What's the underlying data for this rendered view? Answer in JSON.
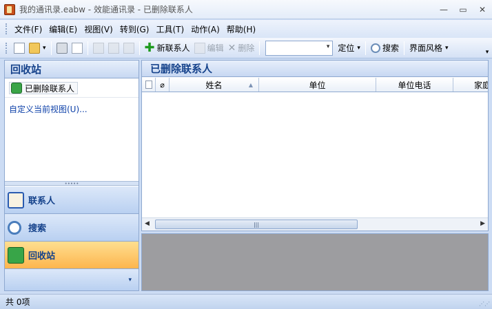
{
  "window": {
    "title": "我的通讯录.eabw - 效能通讯录 - 已删除联系人",
    "minimize_glyph": "—",
    "maximize_glyph": "▭",
    "close_glyph": "✕"
  },
  "menu": [
    {
      "label": "文件(F)"
    },
    {
      "label": "编辑(E)"
    },
    {
      "label": "视图(V)"
    },
    {
      "label": "转到(G)"
    },
    {
      "label": "工具(T)"
    },
    {
      "label": "动作(A)"
    },
    {
      "label": "帮助(H)"
    }
  ],
  "toolbar": {
    "new_contact": "新联系人",
    "edit": "编辑",
    "delete": "删除",
    "combo_value": "",
    "locate": "定位",
    "search": "搜索",
    "theme": "界面风格",
    "icons": {
      "new_doc": "new-document-icon",
      "open": "open-folder-icon",
      "print": "print-icon",
      "preview": "print-preview-icon",
      "cut": "cut-icon",
      "copy": "copy-icon",
      "paste": "paste-icon",
      "plus": "add-icon",
      "edit": "edit-icon",
      "delete": "delete-icon",
      "search": "search-icon"
    }
  },
  "left_pane": {
    "header": "回收站",
    "folder_item": "已删除联系人",
    "customize_link": "自定义当前视图(U)...",
    "nav_buttons": [
      {
        "label": "联系人",
        "icon": "contacts-icon"
      },
      {
        "label": "搜索",
        "icon": "search-icon"
      },
      {
        "label": "回收站",
        "icon": "recycle-bin-icon",
        "active": true
      }
    ]
  },
  "right_pane": {
    "header": "已删除联系人",
    "columns": [
      "",
      "",
      "姓名",
      "单位",
      "单位电话",
      "家庭"
    ],
    "rows": []
  },
  "status": {
    "text": "共 0项"
  },
  "colors": {
    "accent_header_text": "#15428b",
    "active_nav": "#fdb54e",
    "frame_blue": "#ccdcf4",
    "preview_gray": "#9d9da0"
  }
}
